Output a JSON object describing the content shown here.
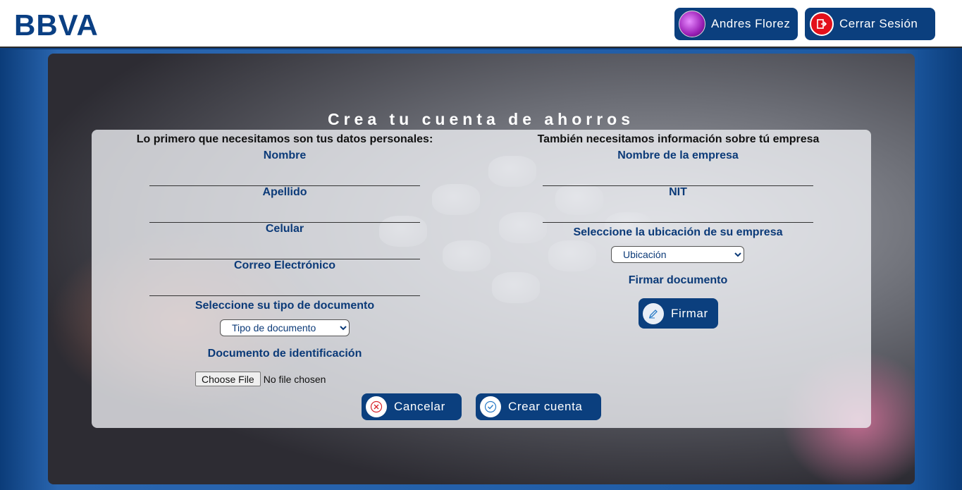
{
  "header": {
    "logo_text": "BBVA",
    "user": {
      "name": "Andres Florez",
      "avatar_icon": "user-avatar"
    },
    "logout": {
      "label": "Cerrar Sesión",
      "icon": "logout-icon"
    }
  },
  "form": {
    "title": "Crea tu cuenta de ahorros",
    "personal": {
      "heading": "Lo primero que necesitamos son tus datos personales:",
      "fields": {
        "nombre": "Nombre",
        "apellido": "Apellido",
        "celular": "Celular",
        "correo": "Correo Electrónico"
      },
      "document_type": {
        "label": "Seleccione su tipo de documento",
        "selected": "Tipo de documento"
      },
      "document_id": {
        "label": "Documento de identificación",
        "file_button": "Choose File",
        "file_status": "No file chosen"
      }
    },
    "company": {
      "heading": "También necesitamos información sobre tú empresa",
      "fields": {
        "nombre_empresa": "Nombre de la empresa",
        "nit": "NIT"
      },
      "location": {
        "label": "Seleccione la ubicación de su empresa",
        "selected": "Ubicación"
      },
      "sign": {
        "label": "Firmar documento",
        "button": "Firmar",
        "icon": "pen-icon"
      }
    },
    "actions": {
      "cancel": "Cancelar",
      "create": "Crear cuenta"
    }
  },
  "colors": {
    "brand_blue": "#0b3f7e",
    "logout_red": "#e3101b",
    "label_blue": "#0b3a78"
  }
}
